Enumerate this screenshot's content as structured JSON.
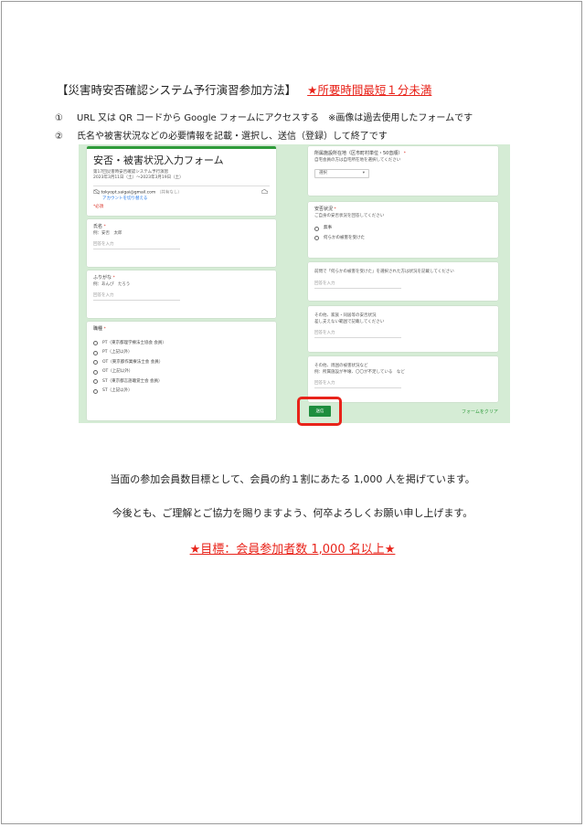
{
  "heading": {
    "title": "【災害時安否確認システム予行演習参加方法】",
    "time_note": "★所要時間最短１分未満"
  },
  "steps": [
    {
      "num": "①",
      "text": "URL 又は QR コードから Google フォームにアクセスする　※画像は過去使用したフォームです"
    },
    {
      "num": "②",
      "text": "氏名や被害状況などの必要情報を記載・選択し、送信（登録）して終了です"
    }
  ],
  "form": {
    "title": "安否・被害状況入力フォーム",
    "subtitle": "第17回災害時安否確認システム予行演習",
    "dates": "2023年3月11日（土）～2023年3月19日（土）",
    "account_email": "tokyopt.saigai@gmail.com",
    "account_note": "（共有なし）",
    "switch_account": "アカウントを切り替える",
    "required_note": "*必須",
    "name_label": "氏名",
    "name_example": "例：安否　太郎",
    "answer_placeholder": "回答を入力",
    "kana_label": "ふりがな",
    "kana_example": "例：あんぴ　たろう",
    "job_label": "職種",
    "job_options": [
      "PT（東京都理学療法士協会 会員）",
      "PT（上記以外）",
      "OT（東京都作業療法士会 会員）",
      "OT（上記以外）",
      "ST（東京都言語聴覚士会 会員）",
      "ST（上記以外）"
    ],
    "location_label": "所属施設所在地（区市町村単位・50音順）",
    "location_note": "自宅会員の方は自宅所在地を選択してください",
    "select_placeholder": "選択",
    "safety_label": "安否状況",
    "safety_note": "ご自身の安否状況を回答してください",
    "safety_options": [
      "無事",
      "何らかの被害を受けた"
    ],
    "damage_label": "前問で「何らかの被害を受けた」を選択された方は状況を記載してください",
    "answer_placeholder_2": "回答を入力",
    "family_label": "その他、家族・同居等の安否状況",
    "family_note": "差し支えない範囲で記載してください",
    "surroundings_label": "その他、周囲の被害状況など",
    "surroundings_note": "例：所属施設が半壊、〇〇が不足している　など",
    "submit_label": "送信",
    "clear_label": "フォームをクリア"
  },
  "paragraphs": [
    "当面の参加会員数目標として、会員の約１割にあたる 1,000 人を掲げています。",
    "今後とも、ご理解とご協力を賜りますよう、何卒よろしくお願い申し上げます。"
  ],
  "goal": "★目標：会員参加者数 1,000 名以上★",
  "colors": {
    "accent": "#e8231a",
    "form_green": "#2e9b3a",
    "form_bg": "#d5ecd5"
  }
}
